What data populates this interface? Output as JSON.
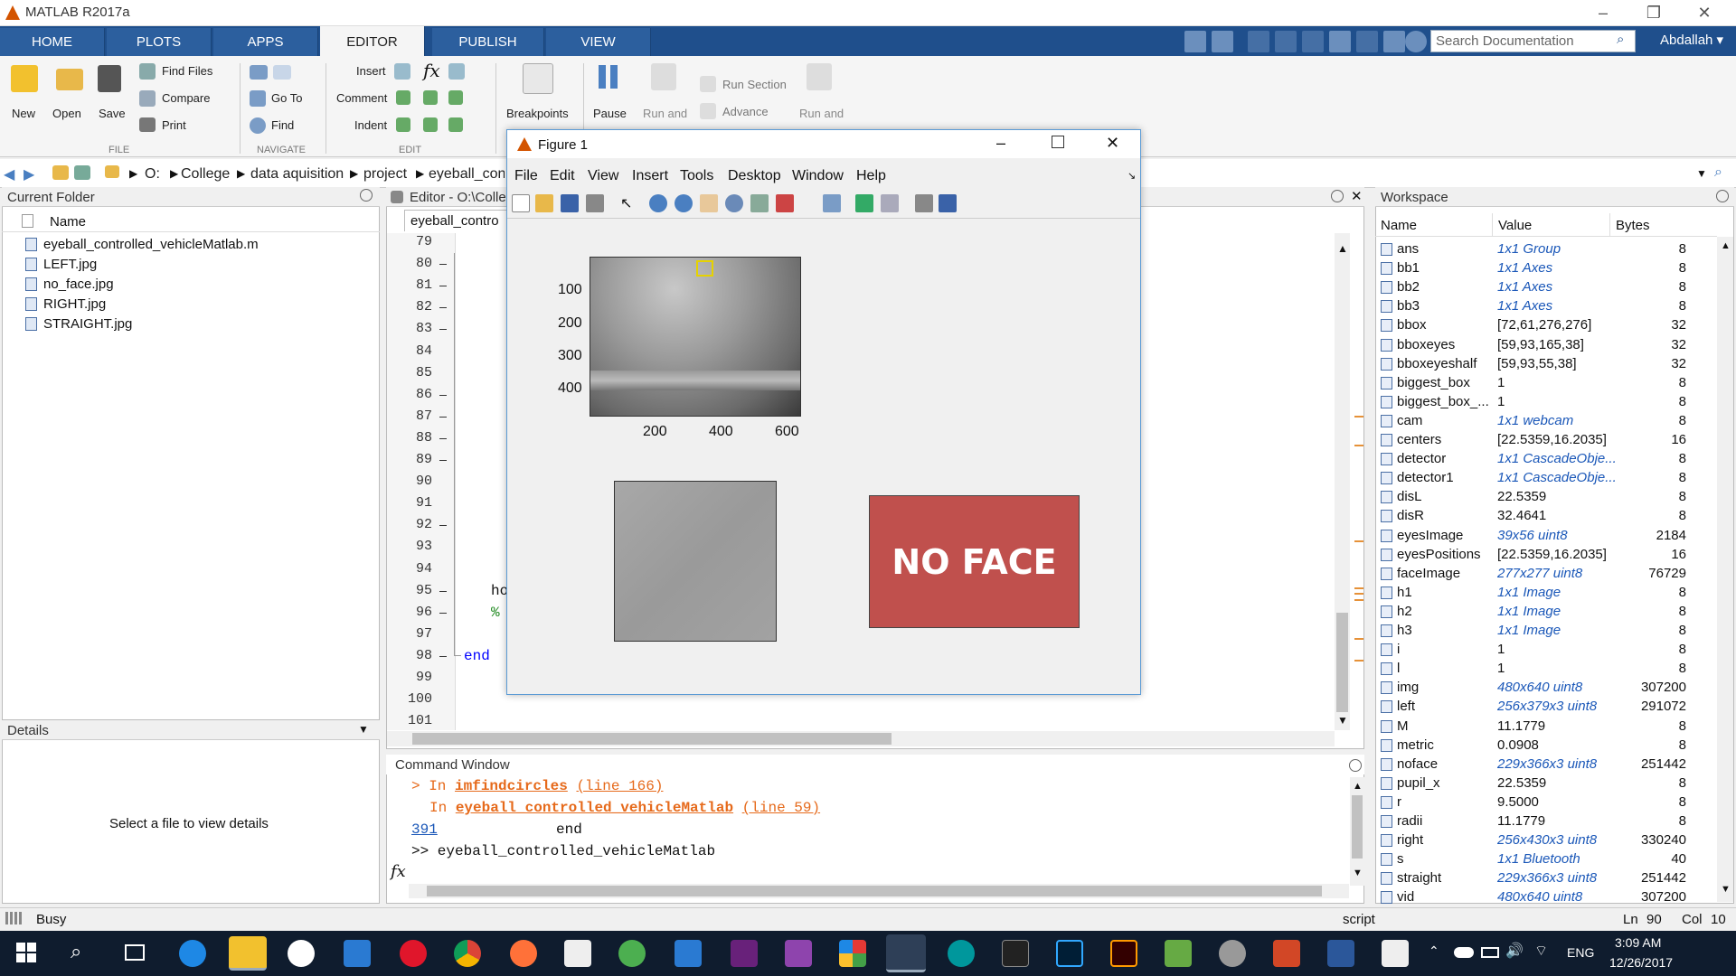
{
  "app": {
    "title": "MATLAB R2017a",
    "user": "Abdallah",
    "search_placeholder": "Search Documentation"
  },
  "tabs": [
    "HOME",
    "PLOTS",
    "APPS",
    "EDITOR",
    "PUBLISH",
    "VIEW"
  ],
  "ribbon": {
    "file": {
      "new": "New",
      "open": "Open",
      "save": "Save",
      "find_files": "Find Files",
      "compare": "Compare",
      "print": "Print",
      "section": "FILE"
    },
    "navigate": {
      "go_to": "Go To",
      "find": "Find",
      "section": "NAVIGATE"
    },
    "edit": {
      "insert": "Insert",
      "comment": "Comment",
      "indent": "Indent",
      "section": "EDIT"
    },
    "breakpoints": "Breakpoints",
    "run": {
      "pause": "Pause",
      "run_advance": "Run and Advance",
      "run_section": "Run Section",
      "advance": "Advance",
      "run_time": "Run and Time"
    }
  },
  "address": {
    "crumbs": [
      "O:",
      "College",
      "data aquisition",
      "project",
      "eyeball_cont"
    ]
  },
  "current_folder": {
    "title": "Current Folder",
    "column": "Name",
    "files": [
      "eyeball_controlled_vehicleMatlab.m",
      "LEFT.jpg",
      "no_face.jpg",
      "RIGHT.jpg",
      "STRAIGHT.jpg"
    ]
  },
  "details": {
    "title": "Details",
    "message": "Select a file to view details"
  },
  "editor": {
    "title": "Editor - O:\\Colle",
    "tab": "eyeball_contro",
    "lines": [
      "79",
      "80",
      "81",
      "82",
      "83",
      "84",
      "85",
      "86",
      "87",
      "88",
      "89",
      "90",
      "91",
      "92",
      "93",
      "94",
      "95",
      "96",
      "97",
      "98",
      "99",
      "100",
      "101"
    ],
    "dash_lines": [
      "80",
      "81",
      "82",
      "83",
      "86",
      "87",
      "88",
      "89",
      "92",
      "95",
      "96",
      "98"
    ],
    "code_ho": "ho",
    "code_pct": "%",
    "code_end": "end"
  },
  "command_window": {
    "title": "Command Window",
    "line1_prefix": "> In ",
    "line1_fn": "imfindcircles",
    "line1_link": "(line 166)",
    "line2_prefix": "In ",
    "line2_fn": "eyeball_controlled_vehicleMatlab",
    "line2_link": "(line 59)",
    "line3_num": "391",
    "line3_end": "end",
    "prompt": ">> eyeball_controlled_vehicleMatlab",
    "fx": "fx"
  },
  "figure": {
    "title": "Figure 1",
    "menu": [
      "File",
      "Edit",
      "View",
      "Insert",
      "Tools",
      "Desktop",
      "Window",
      "Help"
    ],
    "axes_yticks": [
      "100",
      "200",
      "300",
      "400"
    ],
    "axes_xticks": [
      "200",
      "400",
      "600"
    ],
    "no_face_text": "NO FACE",
    "no_face_color": "#c0504d"
  },
  "workspace": {
    "title": "Workspace",
    "columns": [
      "Name",
      "Value",
      "Bytes"
    ],
    "rows": [
      {
        "name": "ans",
        "value": "1x1 Group",
        "bytes": "8",
        "obj": true
      },
      {
        "name": "bb1",
        "value": "1x1 Axes",
        "bytes": "8",
        "obj": true
      },
      {
        "name": "bb2",
        "value": "1x1 Axes",
        "bytes": "8",
        "obj": true
      },
      {
        "name": "bb3",
        "value": "1x1 Axes",
        "bytes": "8",
        "obj": true
      },
      {
        "name": "bbox",
        "value": "[72,61,276,276]",
        "bytes": "32",
        "obj": false
      },
      {
        "name": "bboxeyes",
        "value": "[59,93,165,38]",
        "bytes": "32",
        "obj": false
      },
      {
        "name": "bboxeyeshalf",
        "value": "[59,93,55,38]",
        "bytes": "32",
        "obj": false
      },
      {
        "name": "biggest_box",
        "value": "1",
        "bytes": "8",
        "obj": false
      },
      {
        "name": "biggest_box_...",
        "value": "1",
        "bytes": "8",
        "obj": false
      },
      {
        "name": "cam",
        "value": "1x1 webcam",
        "bytes": "8",
        "obj": true
      },
      {
        "name": "centers",
        "value": "[22.5359,16.2035]",
        "bytes": "16",
        "obj": false
      },
      {
        "name": "detector",
        "value": "1x1 CascadeObje...",
        "bytes": "8",
        "obj": true
      },
      {
        "name": "detector1",
        "value": "1x1 CascadeObje...",
        "bytes": "8",
        "obj": true
      },
      {
        "name": "disL",
        "value": "22.5359",
        "bytes": "8",
        "obj": false
      },
      {
        "name": "disR",
        "value": "32.4641",
        "bytes": "8",
        "obj": false
      },
      {
        "name": "eyesImage",
        "value": "39x56 uint8",
        "bytes": "2184",
        "obj": true
      },
      {
        "name": "eyesPositions",
        "value": "[22.5359,16.2035]",
        "bytes": "16",
        "obj": false
      },
      {
        "name": "faceImage",
        "value": "277x277 uint8",
        "bytes": "76729",
        "obj": true
      },
      {
        "name": "h1",
        "value": "1x1 Image",
        "bytes": "8",
        "obj": true
      },
      {
        "name": "h2",
        "value": "1x1 Image",
        "bytes": "8",
        "obj": true
      },
      {
        "name": "h3",
        "value": "1x1 Image",
        "bytes": "8",
        "obj": true
      },
      {
        "name": "i",
        "value": "1",
        "bytes": "8",
        "obj": false
      },
      {
        "name": "l",
        "value": "1",
        "bytes": "8",
        "obj": false
      },
      {
        "name": "img",
        "value": "480x640 uint8",
        "bytes": "307200",
        "obj": true
      },
      {
        "name": "left",
        "value": "256x379x3 uint8",
        "bytes": "291072",
        "obj": true
      },
      {
        "name": "M",
        "value": "11.1779",
        "bytes": "8",
        "obj": false
      },
      {
        "name": "metric",
        "value": "0.0908",
        "bytes": "8",
        "obj": false
      },
      {
        "name": "noface",
        "value": "229x366x3 uint8",
        "bytes": "251442",
        "obj": true
      },
      {
        "name": "pupil_x",
        "value": "22.5359",
        "bytes": "8",
        "obj": false
      },
      {
        "name": "r",
        "value": "9.5000",
        "bytes": "8",
        "obj": false
      },
      {
        "name": "radii",
        "value": "11.1779",
        "bytes": "8",
        "obj": false
      },
      {
        "name": "right",
        "value": "256x430x3 uint8",
        "bytes": "330240",
        "obj": true
      },
      {
        "name": "s",
        "value": "1x1 Bluetooth",
        "bytes": "40",
        "obj": true
      },
      {
        "name": "straight",
        "value": "229x366x3 uint8",
        "bytes": "251442",
        "obj": true
      },
      {
        "name": "vid",
        "value": "480x640 uint8",
        "bytes": "307200",
        "obj": true
      }
    ]
  },
  "status": {
    "state": "Busy",
    "mode": "script",
    "ln_label": "Ln",
    "ln": "90",
    "col_label": "Col",
    "col": "10"
  },
  "taskbar": {
    "time": "3:09 AM",
    "date": "12/26/2017",
    "lang": "ENG"
  }
}
